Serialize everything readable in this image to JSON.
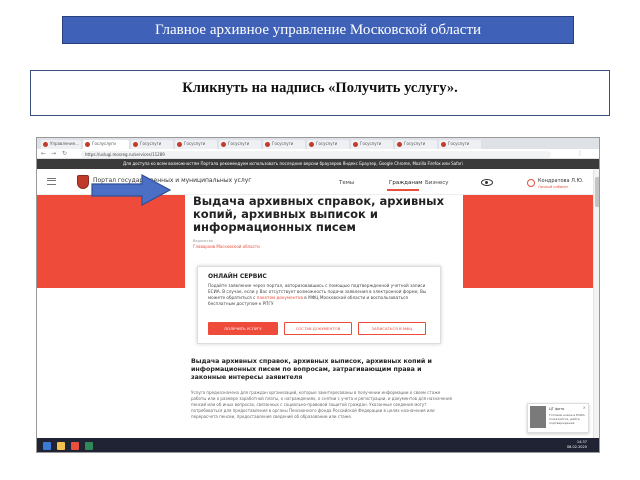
{
  "slide": {
    "header": "Главное архивное управление Московской области",
    "instruction": "Кликнуть на надпись «Получить услугу»."
  },
  "browser": {
    "tabs": [
      "Управление...",
      "Гослуслуги",
      "Госуслуги",
      "Госуслуги",
      "Госуслуги",
      "Госуслуги",
      "Госуслуги",
      "Госуслуги",
      "Госуслуги",
      "Госуслуги"
    ],
    "url": "https://uslugi.mosreg.ru/services/11289",
    "notice": "Для доступа ко всем возможностям Портала рекомендуем использовать последние версии браузеров Яндекс Браузер, Google Chrome, Mozilla Firefox или Safari"
  },
  "portal": {
    "title": "Портал государственных и муниципальных услуг",
    "subtitle": "Московской области",
    "nav": [
      "Темы",
      "Гражданам",
      "Бизнесу"
    ],
    "user_name": "Кондратова Л.Ю.",
    "user_role": "Личный кабинет"
  },
  "service": {
    "title": "Выдача архивных справок, архивных копий, архивных выписок и информационных писем",
    "dept_label": "Ведомство",
    "dept_link": "Главархив Московской области"
  },
  "online": {
    "heading": "ОНЛАЙН СЕРВИС",
    "desc_start": "Подайте заявление через портал, авторизовавшись с помощью подтвержденной учетной записи ЕСИА. В случае, если у Вас отсутствует возможность подачи заявления в электронной форме, Вы можете обратиться с ",
    "desc_link": "пакетом документов",
    "desc_end": " в МФЦ Московской области и воспользоваться бесплатным доступом к РПГУ",
    "btn_get": "ПОЛУЧИТЬ УСЛУГУ",
    "btn_docs": "СОСТАВ ДОКУМЕНТОВ",
    "btn_mfc": "ЗАПИСАТЬСЯ В МФЦ"
  },
  "body": {
    "heading": "Выдача архивных справок, архивных выписок, архивных копий и информационных писем по вопросам, затрагивающим права и законные интересы заявителя",
    "text": "Услуга предназначена для граждан организаций, которые заинтересованы в получении информации о своем стаже работы или о размере заработной платы, о награждениях, о снятии с учета и регистрации, и документов для назначения пенсий или об иных вопросах, связанных с социально-правовой защитой граждан. Указанные сведения могут потребоваться для предоставления в органы Пенсионного фонда Российской Федерации в целях назначения или перерасчета пенсии, предоставления сведений об образовании или стаже."
  },
  "chat": {
    "title": "ЦТ фото",
    "text": "Готовим новое в ЕСИА: пожалуйста, дайте подтверждения"
  },
  "taskbar": {
    "time": "14:37",
    "date": "08.02.2020"
  },
  "colors": {
    "banner": "#3f62b8",
    "accent": "#ef4b3b",
    "arrow": "#4a6fc5"
  }
}
